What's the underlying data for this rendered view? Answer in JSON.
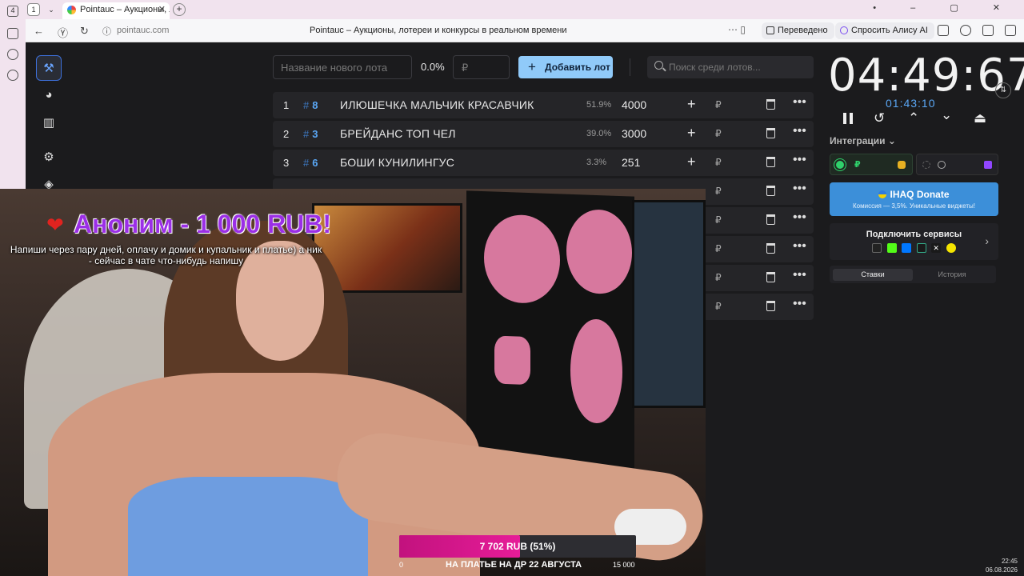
{
  "browser": {
    "tab_count": "1",
    "tab_number": "4",
    "tab_title": "Pointauc – Аукционы, л",
    "url": "pointauc.com",
    "page_title": "Pointauc – Аукционы, лотереи и конкурсы в реальном времени",
    "translate_label": "Переведено",
    "alice_label": "Спросить Алису AI",
    "window_controls": "•  –  ▢  ✕"
  },
  "toolbar": {
    "lot_name_placeholder": "Название нового лота",
    "percent": "0.0%",
    "amount_placeholder": "₽",
    "add_button": "Добавить лот",
    "search_placeholder": "Поиск среди лотов..."
  },
  "lots": [
    {
      "num": "1",
      "id": "8",
      "name": "ИЛЮШЕЧКА МАЛЬЧИК КРАСАВЧИК",
      "pct": "51.9%",
      "amount": "4000"
    },
    {
      "num": "2",
      "id": "3",
      "name": "БРЕЙДАНС ТОП ЧЕЛ",
      "pct": "39.0%",
      "amount": "3000"
    },
    {
      "num": "3",
      "id": "6",
      "name": "БОШИ КУНИЛИНГУС",
      "pct": "3.3%",
      "amount": "251"
    }
  ],
  "currency_symbol": "₽",
  "timer": {
    "main": "04:49:67",
    "sub": "01:43:10"
  },
  "integrations_label": "Интеграции",
  "donate": {
    "title": "IHAQ Donate",
    "subtitle": "Комиссия — 3,5%. Уникальные виджеты!"
  },
  "connect": {
    "title": "Подключить сервисы"
  },
  "history_tabs": {
    "bets": "Ставки",
    "history": "История"
  },
  "stream_overlay": {
    "donation_title": "Аноним - 1 000 RUB!",
    "donation_message": "Напиши через пару дней, оплачу и домик и купальник и платье) а ник - сейчас в чате что-нибудь напишу",
    "goal_label": "7 702 RUB (51%)",
    "goal_progress": 0.51,
    "goal_min": "0",
    "goal_max": "15 000",
    "goal_title": "НА ПЛАТЬЕ НА ДР 22 АВГУСТА"
  },
  "clock": {
    "time": "22:45",
    "date": "06.08.2026"
  },
  "colors": {
    "accent": "#90caf9",
    "link_blue": "#5aa7f5",
    "donate_blue": "#3c8fd9",
    "goal_pink": "#e61c98",
    "donation_purple": "#9b2fe6"
  }
}
